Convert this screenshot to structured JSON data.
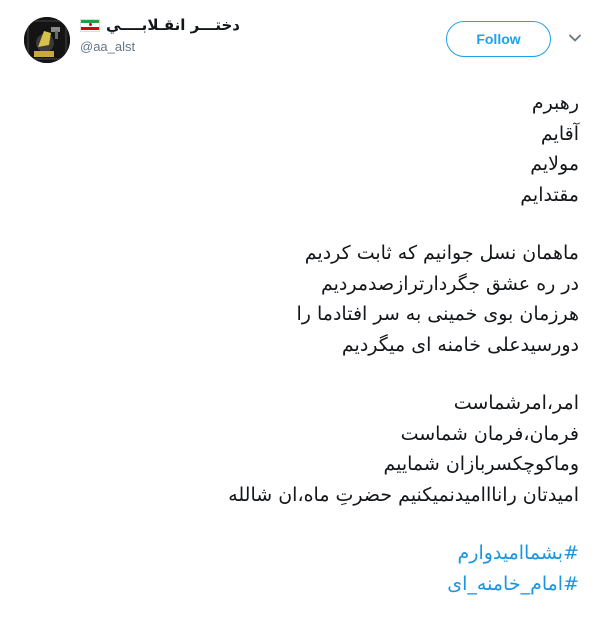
{
  "user": {
    "display_name": "دختـــر انقـلابــــي",
    "handle": "@aa_alst"
  },
  "follow_label": "Follow",
  "tweet": {
    "stanza1": [
      "رهبرم",
      "آقایم",
      "مولایم",
      "مقتدایم"
    ],
    "stanza2": [
      "ماهمان نسل جوانیم که ثابت کردیم",
      "در ره عشق جگردارترازصدمردیم",
      "هرزمان بوی خمینی به سر افتادما را",
      "دورسیدعلی خامنه ای میگردیم"
    ],
    "stanza3": [
      "امر،امرشماست",
      "فرمان،فرمان شماست",
      "وماکوچکسربازان شماییم",
      "امیدتان رانااامیدنمیکنیم حضرتِ ماه،ان شالله"
    ],
    "hashtags": [
      "#بشماامیدوارم",
      "#امام_خامنه_ای"
    ]
  },
  "colors": {
    "accent": "#1da1f2",
    "hashtag": "#1b95e0",
    "text": "#14171a",
    "muted": "#657786"
  }
}
